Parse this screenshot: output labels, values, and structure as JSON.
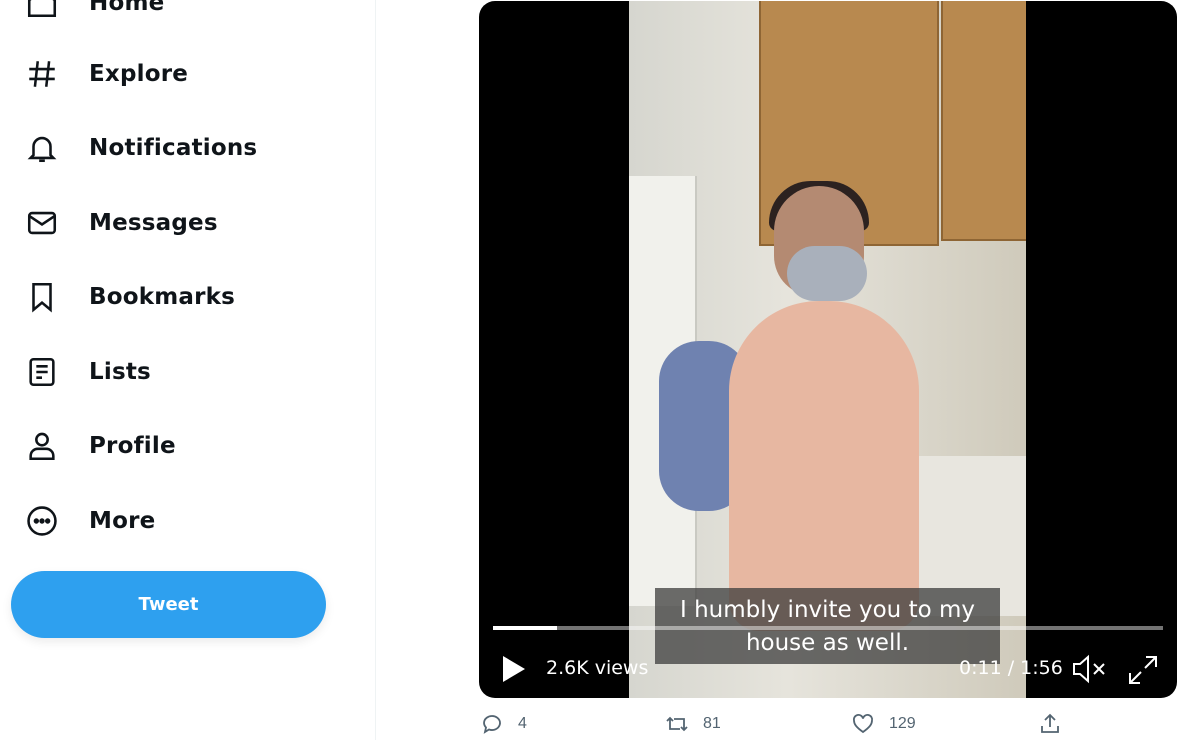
{
  "sidebar": {
    "items": [
      {
        "label": "Home",
        "icon": "home-icon"
      },
      {
        "label": "Explore",
        "icon": "hashtag-icon"
      },
      {
        "label": "Notifications",
        "icon": "bell-icon"
      },
      {
        "label": "Messages",
        "icon": "envelope-icon"
      },
      {
        "label": "Bookmarks",
        "icon": "bookmark-icon"
      },
      {
        "label": "Lists",
        "icon": "list-icon"
      },
      {
        "label": "Profile",
        "icon": "person-icon"
      },
      {
        "label": "More",
        "icon": "more-circle-icon"
      }
    ],
    "tweet_button": "Tweet"
  },
  "video": {
    "caption_line1": "I humbly invite you to my",
    "caption_line2": "house as well.",
    "views": "2.6K views",
    "time": "0:11 / 1:56",
    "progress": 0.095
  },
  "tweet_actions": {
    "replies": "4",
    "retweets": "81",
    "likes": "129"
  },
  "colors": {
    "accent": "#1d9bf0",
    "text": "#0f1419",
    "muted": "#536471"
  }
}
